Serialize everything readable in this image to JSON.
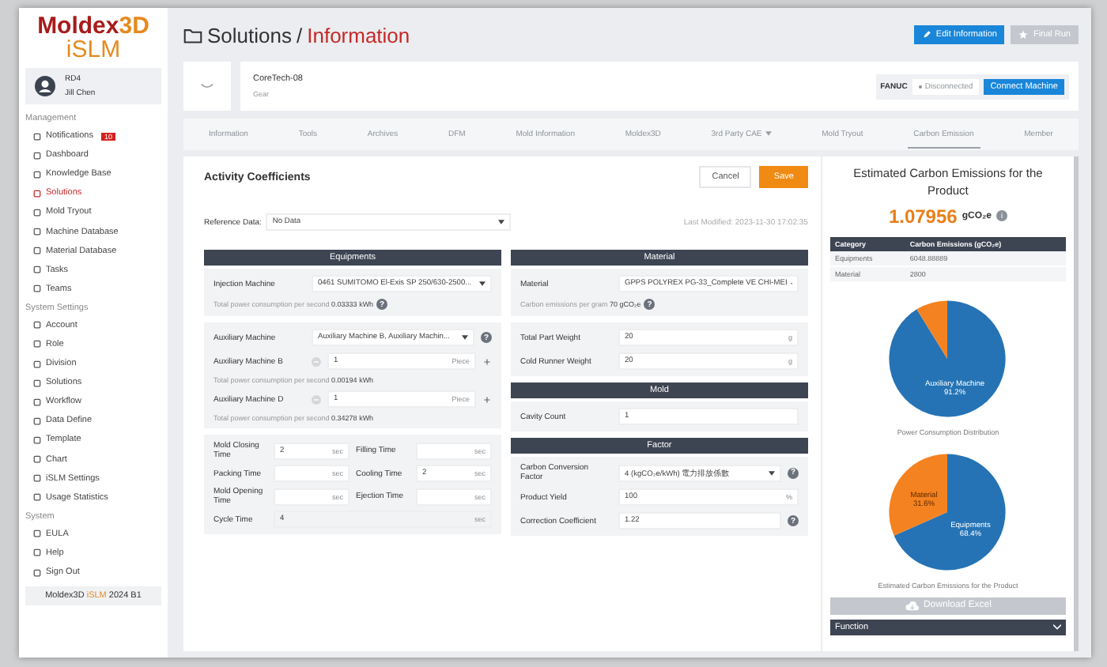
{
  "logo": {
    "name": "Moldex",
    "suffix": "3D",
    "product": "iSLM"
  },
  "user": {
    "org": "RD4",
    "name": "Jill Chen"
  },
  "sidebar": [
    {
      "title": "Management",
      "items": [
        {
          "label": "Notifications",
          "badge": "10",
          "selected": false
        },
        {
          "label": "Dashboard",
          "selected": false
        },
        {
          "label": "Knowledge Base",
          "selected": false
        },
        {
          "label": "Solutions",
          "selected": true
        },
        {
          "label": "Mold Tryout",
          "selected": false
        },
        {
          "label": "Machine Database",
          "selected": false
        },
        {
          "label": "Material Database",
          "selected": false
        },
        {
          "label": "Tasks",
          "selected": false
        },
        {
          "label": "Teams",
          "selected": false
        }
      ]
    },
    {
      "title": "System Settings",
      "items": [
        {
          "label": "Account",
          "selected": false
        },
        {
          "label": "Role",
          "selected": false
        },
        {
          "label": "Division",
          "selected": false
        },
        {
          "label": "Solutions",
          "selected": false
        },
        {
          "label": "Workflow",
          "selected": false
        },
        {
          "label": "Data Define",
          "selected": false
        },
        {
          "label": "Template",
          "selected": false
        },
        {
          "label": "Chart",
          "selected": false
        },
        {
          "label": "iSLM Settings",
          "selected": false
        },
        {
          "label": "Usage Statistics",
          "selected": false
        }
      ]
    },
    {
      "title": "System",
      "items": [
        {
          "label": "EULA",
          "selected": false
        },
        {
          "label": "Help",
          "selected": false
        },
        {
          "label": "Sign Out",
          "selected": false
        }
      ]
    }
  ],
  "version": {
    "name": "Moldex3D",
    "product": "iSLM",
    "release": "2024 B1"
  },
  "breadcrumb": {
    "section": "Solutions",
    "separator": "/",
    "page": "Information"
  },
  "header_buttons": [
    {
      "label": "Edit Information",
      "kind": "edit",
      "disabled": false
    },
    {
      "label": "Final Run",
      "kind": "star",
      "disabled": true
    }
  ],
  "solution": {
    "name": "CoreTech-08",
    "type": "Gear",
    "machine_brand": "FANUC",
    "machine_status": "Disconnected",
    "connected": false,
    "connect_button": "Connect Machine"
  },
  "tabs": [
    {
      "label": "Information",
      "selected": false
    },
    {
      "label": "Tools",
      "selected": false
    },
    {
      "label": "Archives",
      "selected": false
    },
    {
      "label": "DFM",
      "selected": false
    },
    {
      "label": "Mold Information",
      "selected": false
    },
    {
      "label": "Moldex3D",
      "selected": false
    },
    {
      "label": "3rd Party CAE",
      "selected": false,
      "dropdown": true
    },
    {
      "label": "Mold Tryout",
      "selected": false
    },
    {
      "label": "Carbon Emission",
      "selected": true
    },
    {
      "label": "Member",
      "selected": false
    }
  ],
  "activity": {
    "title": "Activity Coefficients",
    "cancel": "Cancel",
    "save": "Save",
    "reference_label": "Reference Data:",
    "reference_value": "No Data",
    "last_modified": "Last Modified: 2023-11-30 17:02:35"
  },
  "equipments": {
    "title": "Equipments",
    "injection": {
      "label": "Injection Machine",
      "value": "0461 SUMITOMO El-Exis SP 250/630-2500...",
      "note": "Total power consumption per second **0.03333 kWh**",
      "help": "?"
    },
    "auxiliary": {
      "label": "Auxiliary Machine",
      "value": "Auxiliary Machine B, Auxiliary Machin...",
      "help": "?",
      "machines": [
        {
          "label": "Auxiliary Machine B",
          "count": "1",
          "unit": "Piece",
          "note": "Total power consumption per second **0.00194 kWh**"
        },
        {
          "label": "Auxiliary Machine D",
          "count": "1",
          "unit": "Piece",
          "note": "Total power consumption per second **0.34278 kWh**"
        }
      ]
    },
    "times": [
      {
        "label": "Mold Closing Time",
        "value": "2",
        "unit": "sec"
      },
      {
        "label": "Filling Time",
        "unit": "sec"
      },
      {
        "label": "Packing Time",
        "unit": "sec"
      },
      {
        "label": "Cooling Time",
        "value": "2",
        "unit": "sec"
      },
      {
        "label": "Mold Opening Time",
        "unit": "sec"
      },
      {
        "label": "Ejection Time",
        "unit": "sec"
      }
    ],
    "cycle_time": {
      "label": "Cycle Time",
      "value": "4",
      "unit": "sec"
    }
  },
  "material": {
    "title": "Material",
    "label": "Material",
    "value": "GPPS POLYREX PG-33_Complete VE CHI-MEI",
    "note": "Carbon emissions per gram **70 gCO₂e**",
    "help": "?",
    "weights": [
      {
        "label": "Total Part Weight",
        "value": "20",
        "unit": "g"
      },
      {
        "label": "Cold Runner Weight",
        "value": "20",
        "unit": "g"
      }
    ]
  },
  "mold": {
    "title": "Mold",
    "label": "Cavity Count",
    "value": "1"
  },
  "factor": {
    "title": "Factor",
    "fields": [
      {
        "kind": "select",
        "label": "Carbon Conversion Factor",
        "value": "4 (kgCO₂e/kWh) 電力排放係數",
        "help": "?"
      },
      {
        "kind": "input",
        "label": "Product Yield",
        "value": "100",
        "unit": "%"
      },
      {
        "kind": "input",
        "label": "Correction Coefficient",
        "value": "1.22",
        "help": "?"
      }
    ]
  },
  "summary": {
    "title": "Estimated Carbon Emissions for the Product",
    "total": "1.07956",
    "unit": "gCO₂e",
    "info": "i",
    "columns": [
      "Category",
      "Carbon Emissions (gCO₂e)"
    ],
    "rows": [
      [
        "Equipments",
        "6048.88889"
      ],
      [
        "Material",
        "2800"
      ]
    ],
    "charts": [
      {
        "chart_data": {
          "type": "pie",
          "title": "Power Consumption Distribution",
          "categories": [
            "Auxiliary Machine",
            null
          ],
          "values": [
            91.2,
            8.8
          ],
          "value_labels": [
            "91.2%",
            null
          ]
        }
      },
      {
        "chart_data": {
          "type": "pie",
          "title": "Estimated Carbon Emissions for the Product",
          "categories": [
            "Equipments",
            "Material"
          ],
          "values": [
            68.4,
            31.6
          ],
          "value_labels": [
            "68.4%",
            "31.6%"
          ]
        }
      }
    ],
    "download": {
      "label": "Download Excel",
      "disabled": true
    },
    "function": "Function"
  }
}
